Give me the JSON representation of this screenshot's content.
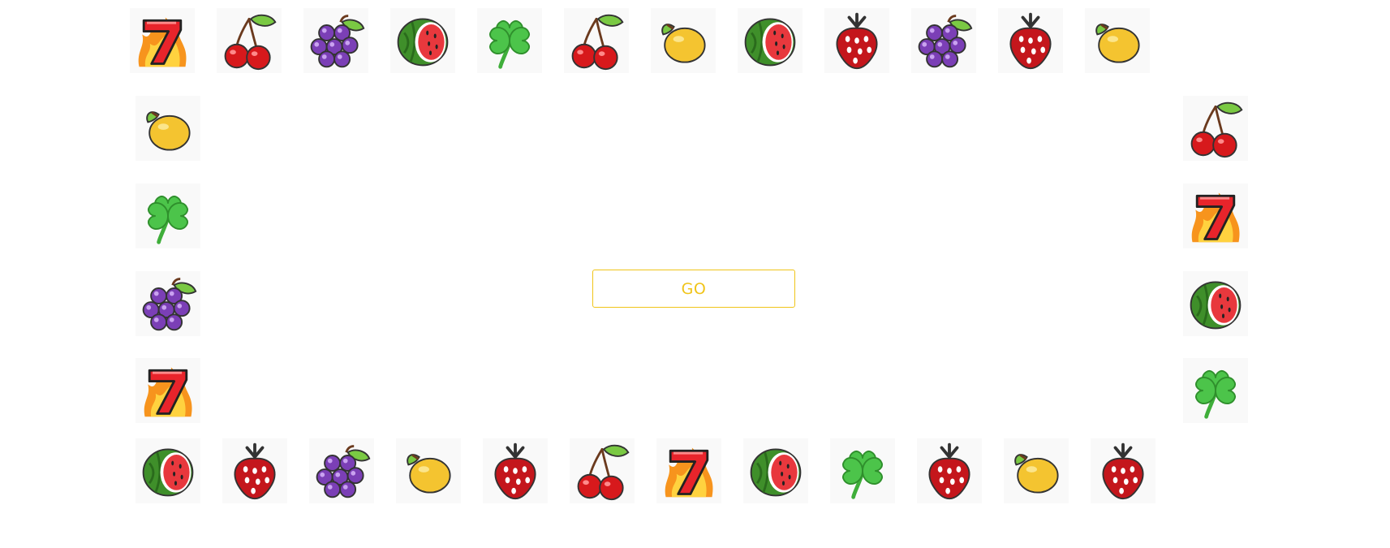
{
  "colors": {
    "accent": "#f0c419",
    "background": "#ffffff",
    "tile_background": "#f9f9f9"
  },
  "button": {
    "label": "GO"
  },
  "ring": {
    "top": [
      "seven-icon",
      "cherry-icon",
      "grapes-icon",
      "watermelon-icon",
      "clover-icon",
      "cherry-icon",
      "lemon-icon",
      "watermelon-icon",
      "strawberry-icon",
      "grapes-icon",
      "strawberry-icon",
      "lemon-icon"
    ],
    "left": [
      "lemon-icon",
      "clover-icon",
      "grapes-icon",
      "seven-icon"
    ],
    "right": [
      "cherry-icon",
      "seven-icon",
      "watermelon-icon",
      "clover-icon"
    ],
    "bottom": [
      "watermelon-icon",
      "strawberry-icon",
      "grapes-icon",
      "lemon-icon",
      "strawberry-icon",
      "cherry-icon",
      "seven-icon",
      "watermelon-icon",
      "clover-icon",
      "strawberry-icon",
      "lemon-icon",
      "strawberry-icon"
    ]
  }
}
